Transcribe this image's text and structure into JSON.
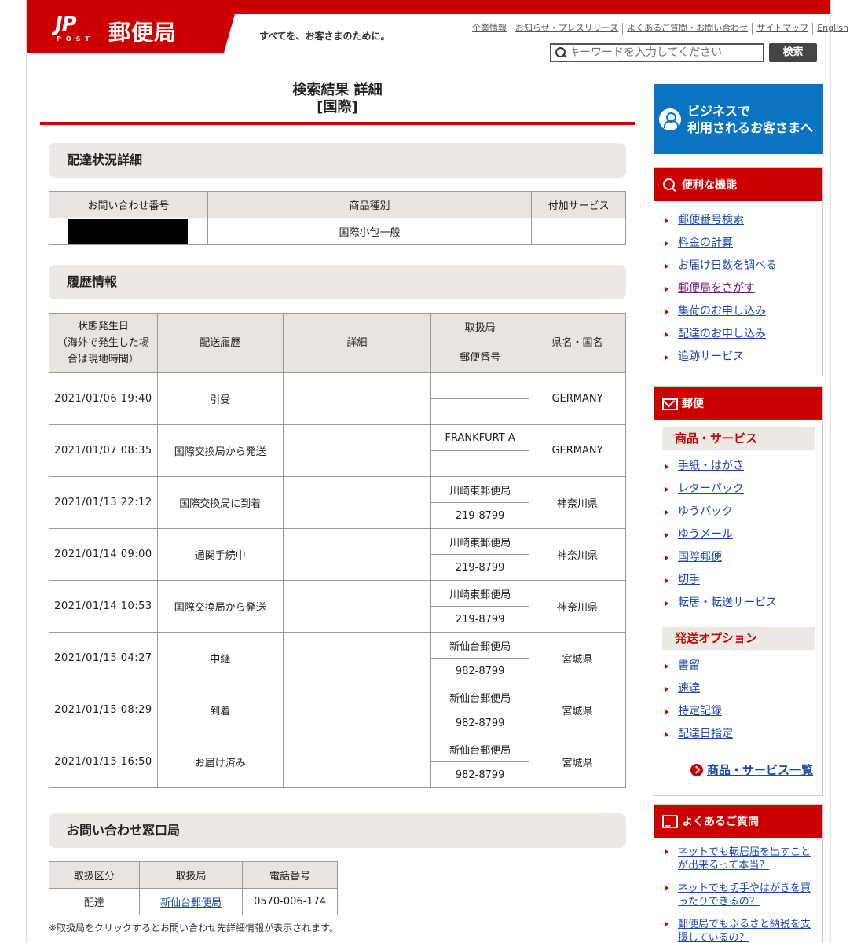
{
  "header": {
    "logo_mark": "JP",
    "logo_post": "POST",
    "logo_name": "郵便局",
    "tagline": "すべてを、お客さまのために。",
    "util_links": [
      "企業情報",
      "お知らせ・プレスリリース",
      "よくあるご質問・お問い合わせ",
      "サイトマップ",
      "English"
    ],
    "search_placeholder": "キーワードを入力してください",
    "search_button": "検索"
  },
  "title": {
    "line1": "検索結果 詳細",
    "line2": "[国際]"
  },
  "delivery_detail": {
    "heading": "配達状況詳細",
    "columns": [
      "お問い合わせ番号",
      "商品種別",
      "付加サービス"
    ],
    "row": {
      "tracking_number": "",
      "product_type": "国際小包一般",
      "extra_service": ""
    }
  },
  "history": {
    "heading": "履歴情報",
    "columns": {
      "date": "状態発生日（海外で発生した場合は現地時間）",
      "date_lines": [
        "状態発生日",
        "（海外で発生した場",
        "合は現地時間）"
      ],
      "status": "配送履歴",
      "detail": "詳細",
      "office": "取扱局",
      "postal": "郵便番号",
      "region": "県名・国名"
    },
    "rows": [
      {
        "date": "2021/01/06 19:40",
        "status": "引受",
        "detail": "",
        "office": "",
        "postal": "",
        "region": "GERMANY"
      },
      {
        "date": "2021/01/07 08:35",
        "status": "国際交換局から発送",
        "detail": "",
        "office": "FRANKFURT A",
        "postal": "",
        "region": "GERMANY"
      },
      {
        "date": "2021/01/13 22:12",
        "status": "国際交換局に到着",
        "detail": "",
        "office": "川崎東郵便局",
        "postal": "219-8799",
        "region": "神奈川県"
      },
      {
        "date": "2021/01/14 09:00",
        "status": "通関手続中",
        "detail": "",
        "office": "川崎東郵便局",
        "postal": "219-8799",
        "region": "神奈川県"
      },
      {
        "date": "2021/01/14 10:53",
        "status": "国際交換局から発送",
        "detail": "",
        "office": "川崎東郵便局",
        "postal": "219-8799",
        "region": "神奈川県"
      },
      {
        "date": "2021/01/15 04:27",
        "status": "中継",
        "detail": "",
        "office": "新仙台郵便局",
        "postal": "982-8799",
        "region": "宮城県"
      },
      {
        "date": "2021/01/15 08:29",
        "status": "到着",
        "detail": "",
        "office": "新仙台郵便局",
        "postal": "982-8799",
        "region": "宮城県"
      },
      {
        "date": "2021/01/15 16:50",
        "status": "お届け済み",
        "detail": "",
        "office": "新仙台郵便局",
        "postal": "982-8799",
        "region": "宮城県"
      }
    ]
  },
  "contact": {
    "heading": "お問い合わせ窓口局",
    "columns": [
      "取扱区分",
      "取扱局",
      "電話番号"
    ],
    "row": {
      "category": "配達",
      "office": "新仙台郵便局",
      "phone": "0570-006-174"
    },
    "footnote": "※取扱局をクリックするとお問い合わせ先詳細情報が表示されます。"
  },
  "sidebar": {
    "business_banner": {
      "line1": "ビジネスで",
      "line2": "利用されるお客さまへ"
    },
    "useful": {
      "heading": "便利な機能",
      "items": [
        "郵便番号検索",
        "料金の計算",
        "お届け日数を調べる",
        "郵便局をさがす",
        "集荷のお申し込み",
        "配達のお申し込み",
        "追跡サービス"
      ]
    },
    "mail": {
      "heading": "郵便",
      "products_heading": "商品・サービス",
      "products": [
        "手紙・はがき",
        "レターパック",
        "ゆうパック",
        "ゆうメール",
        "国際郵便",
        "切手",
        "転居・転送サービス"
      ],
      "options_heading": "発送オプション",
      "options": [
        "書留",
        "速達",
        "特定記録",
        "配達日指定"
      ],
      "all_link": "商品・サービス一覧"
    },
    "faq": {
      "heading": "よくあるご質問",
      "items": [
        "ネットでも転居届を出すことが出来るって本当？",
        "ネットでも切手やはがきを買ったりできるの？",
        "郵便局でもふるさと納税を支援しているの？"
      ]
    }
  },
  "colors": {
    "brand_red": "#cc0000",
    "link_blue": "#1a4aa8",
    "business_blue": "#0a73c2"
  }
}
